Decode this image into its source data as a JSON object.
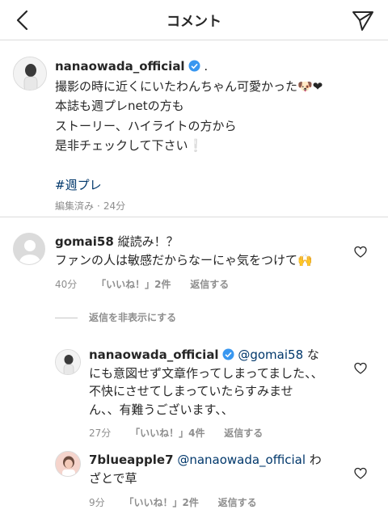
{
  "header": {
    "title": "コメント"
  },
  "caption": {
    "username": "nanaowada_official",
    "lines": [
      "撮影の時に近くにいたわんちゃん可愛かった🐶❤",
      "本誌も週プレnetの方も",
      "ストーリー、ハイライトの方から",
      "是非チェックして下さい❕"
    ],
    "first_suffix": ".",
    "hashtag": "#週プレ",
    "edited": "編集済み",
    "time": "24分"
  },
  "comments": [
    {
      "username": "gomai58",
      "text_1": "縦読み！？",
      "text_2": "ファンの人は敏感だからなーにゃ気をつけて🙌",
      "time": "40分",
      "likes": "「いいね！」2件",
      "reply": "返信する"
    }
  ],
  "hide_replies": "返信を非表示にする",
  "replies": [
    {
      "username": "nanaowada_official",
      "mention": "@gomai58",
      "text_1": "な",
      "text_2": "にも意図せず文章作ってしまってました、、",
      "text_3": "不快にさせてしまっていたらすみませ",
      "text_4": "ん、、有難うございます、、",
      "time": "27分",
      "likes": "「いいね！」4件",
      "reply": "返信する"
    },
    {
      "username": "7blueapple7",
      "mention": "@nanaowada_official",
      "text_1": "わ",
      "text_2": "ざとで草",
      "time": "9分",
      "likes": "「いいね！」2件",
      "reply": "返信する"
    }
  ]
}
